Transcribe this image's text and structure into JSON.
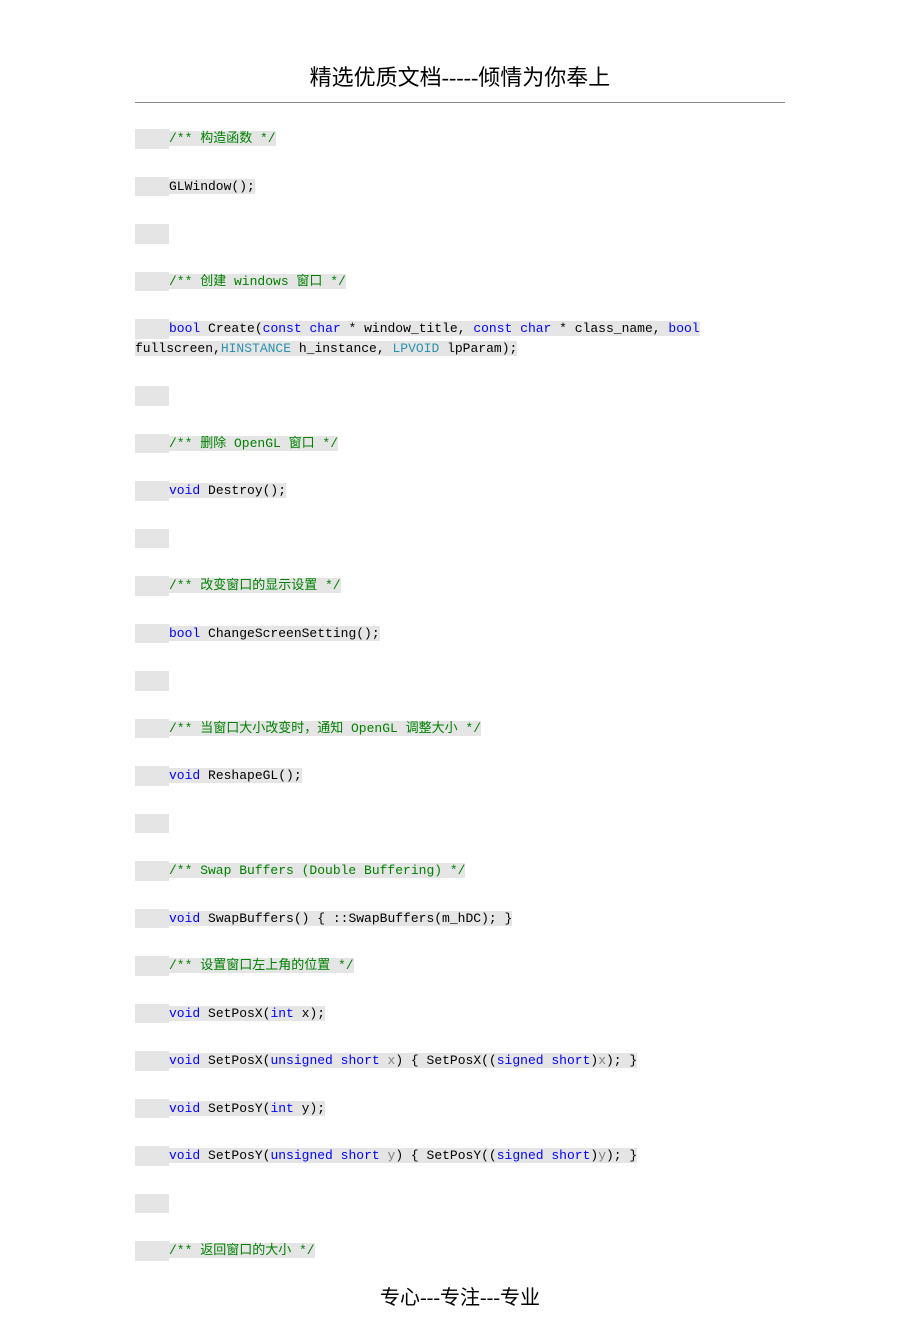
{
  "header": "精选优质文档-----倾情为你奉上",
  "footer": "专心---专注---专业",
  "lines": {
    "l1_comment": "/** 构造函数 */",
    "l2_text": "GLWindow();",
    "l3_blank": " ",
    "l4_comment": "/** 创建 windows 窗口 */",
    "l5_kw1": "bool",
    "l5_t1": " Create(",
    "l5_kw2": "const",
    "l5_t2": " ",
    "l5_kw3": "char",
    "l5_t3": " * window_title, ",
    "l5_kw4": "const",
    "l5_t4": " ",
    "l5_kw5": "char",
    "l5_t5": " * class_name, ",
    "l5_kw6": "bool",
    "l5_t6": " fullscreen,",
    "l5_ty1": "HINSTANCE",
    "l5_t7": " h_instance, ",
    "l5_ty2": "LPVOID",
    "l5_t8": " lpParam);",
    "l6_blank": " ",
    "l7_comment": "/** 删除 OpenGL 窗口 */",
    "l8_kw": "void",
    "l8_t": " Destroy();",
    "l9_blank": " ",
    "l10_comment": "/** 改变窗口的显示设置 */",
    "l11_kw": "bool",
    "l11_t": " ChangeScreenSetting();",
    "l12_blank": " ",
    "l13_comment": "/** 当窗口大小改变时，通知 OpenGL 调整大小 */",
    "l14_kw": "void",
    "l14_t": " ReshapeGL();",
    "l15_blank": " ",
    "l16_comment": "/** Swap Buffers (Double Buffering) */",
    "l17_kw": "void",
    "l17_t": " SwapBuffers() { ::SwapBuffers(m_hDC); }",
    "l18_comment": "/** 设置窗口左上角的位置 */",
    "l19_kw": "void",
    "l19_t1": " SetPosX(",
    "l19_kw2": "int",
    "l19_t2": " x);",
    "l20_kw": "void",
    "l20_t1": " SetPosX(",
    "l20_kw2": "unsigned",
    "l20_t2": " ",
    "l20_kw3": "short",
    "l20_t3": " ",
    "l20_id": "x",
    "l20_t4": ") { SetPosX((",
    "l20_kw4": "signed",
    "l20_t5": " ",
    "l20_kw5": "short",
    "l20_t6": ")",
    "l20_id2": "x",
    "l20_t7": "); }",
    "l21_kw": "void",
    "l21_t1": " SetPosY(",
    "l21_kw2": "int",
    "l21_t2": " y);",
    "l22_kw": "void",
    "l22_t1": " SetPosY(",
    "l22_kw2": "unsigned",
    "l22_t2": " ",
    "l22_kw3": "short",
    "l22_t3": " ",
    "l22_id": "y",
    "l22_t4": ") { SetPosY((",
    "l22_kw4": "signed",
    "l22_t5": " ",
    "l22_kw5": "short",
    "l22_t6": ")",
    "l22_id2": "y",
    "l22_t7": "); }",
    "l23_blank": " ",
    "l24_comment": "/** 返回窗口的大小 */"
  }
}
